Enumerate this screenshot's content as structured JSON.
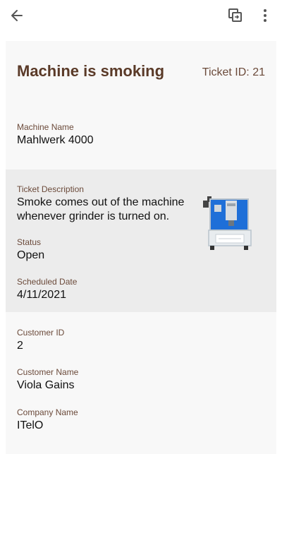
{
  "header": {
    "back_icon": "arrow-left-icon",
    "copy_icon": "copy-icon",
    "more_icon": "more-vert-icon"
  },
  "ticket": {
    "title": "Machine is smoking",
    "ticket_id": "Ticket ID: 21",
    "machine_name_label": "Machine Name",
    "machine_name": "Mahlwerk 4000",
    "description_label": "Ticket Description",
    "description_line1": "Smoke comes out of the machine",
    "description_line2": "whenever grinder is turned on.",
    "status_label": "Status",
    "status": "Open",
    "scheduled_label": "Scheduled Date",
    "scheduled": "4/11/2021",
    "customer_id_label": "Customer ID",
    "customer_id": "2",
    "customer_name_label": "Customer Name",
    "customer_name": "Viola Gains",
    "company_label": "Company Name",
    "company": "ITelO"
  },
  "colors": {
    "title": "#5a3a28",
    "label": "#6b4a3a",
    "card_bg": "#f8f8f8",
    "highlight_bg": "#ececec",
    "machine_blue": "#1e6fd8"
  }
}
